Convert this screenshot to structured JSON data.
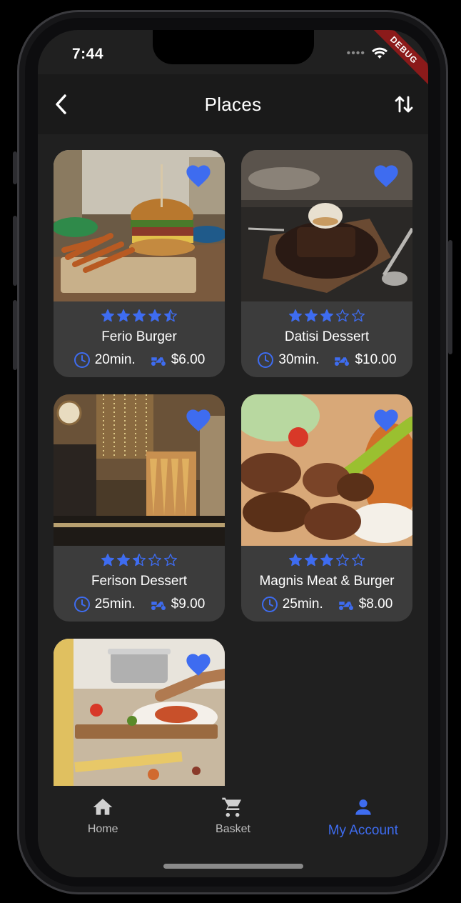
{
  "status": {
    "time": "7:44",
    "debug_label": "DEBUG"
  },
  "appbar": {
    "title": "Places"
  },
  "accent_color": "#3e6cf0",
  "places": [
    {
      "name": "Ferio Burger",
      "rating": 4.5,
      "time": "20min.",
      "fee": "$6.00",
      "favorite": true
    },
    {
      "name": "Datisi Dessert",
      "rating": 3,
      "time": "30min.",
      "fee": "$10.00",
      "favorite": true
    },
    {
      "name": "Ferison Dessert",
      "rating": 2.5,
      "time": "25min.",
      "fee": "$9.00",
      "favorite": true
    },
    {
      "name": "Magnis Meat & Burger",
      "rating": 3,
      "time": "25min.",
      "fee": "$8.00",
      "favorite": true
    },
    {
      "name": "",
      "rating": null,
      "time": "",
      "fee": "",
      "favorite": true
    }
  ],
  "bottom_nav": {
    "items": [
      {
        "label": "Home",
        "icon": "home-icon",
        "active": false
      },
      {
        "label": "Basket",
        "icon": "cart-icon",
        "active": false
      },
      {
        "label": "My Account",
        "icon": "person-icon",
        "active": true
      }
    ]
  }
}
